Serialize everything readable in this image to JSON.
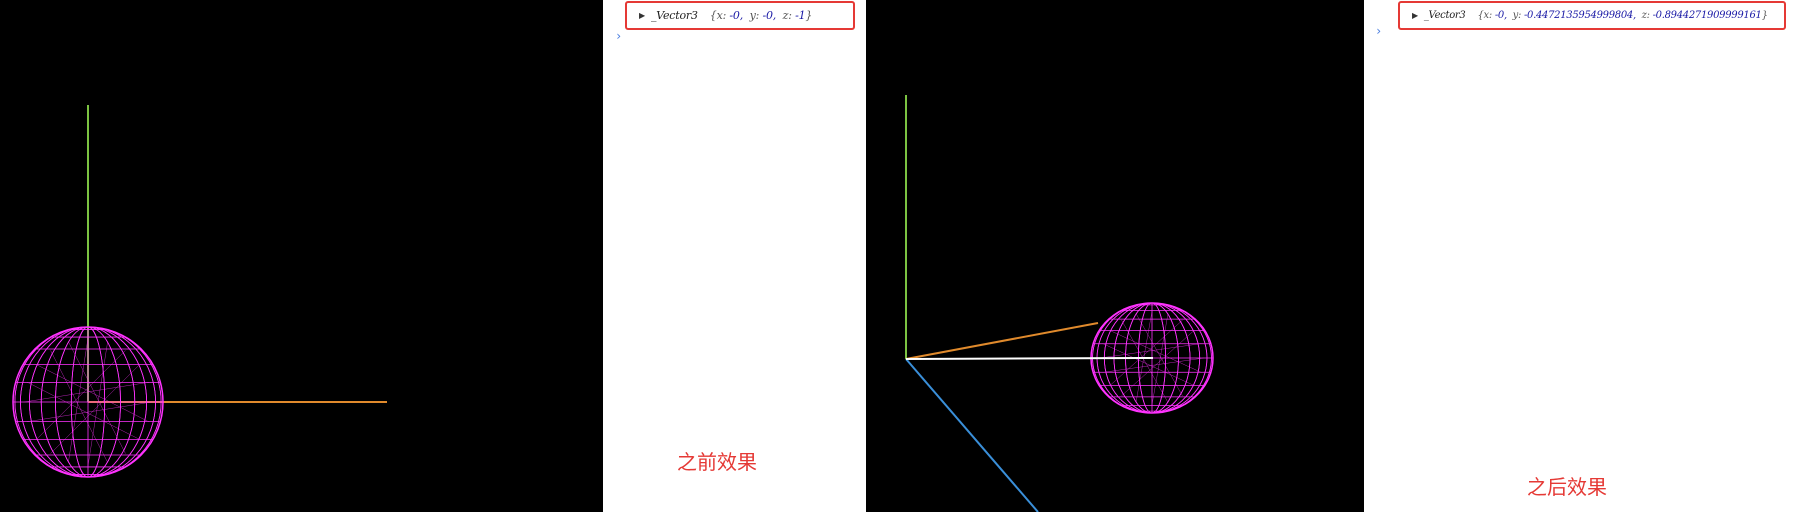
{
  "before": {
    "console_log": {
      "class_name": "_Vector3",
      "x_label": "x:",
      "x_value": "-0,",
      "y_label": "y:",
      "y_value": "-0,",
      "z_label": "z:",
      "z_value": "-1",
      "open_brace": "{",
      "close_brace": "}"
    },
    "prompt": "›",
    "caption": "之前效果"
  },
  "after": {
    "console_log": {
      "class_name": "_Vector3",
      "x_label": "x:",
      "x_value": "-0,",
      "y_label": "y:",
      "y_value": "-0.4472135954999804,",
      "z_label": "z:",
      "z_value": "-0.8944271909999161",
      "open_brace": "{",
      "close_brace": "}"
    },
    "prompt": "›",
    "caption": "之后效果"
  },
  "colors": {
    "sphere": "#ff33ff",
    "axis_y": "#7cc342",
    "axis_x": "#e08a2c",
    "axis_z": "#3a8fd9",
    "highlight": "#e53935"
  }
}
